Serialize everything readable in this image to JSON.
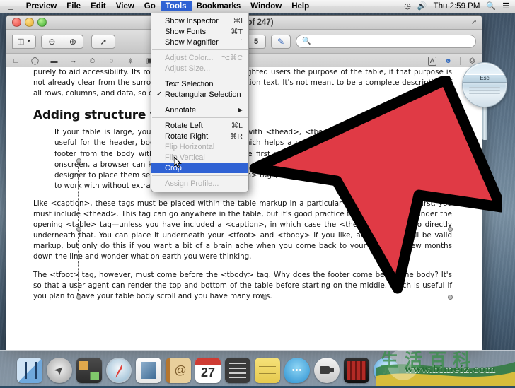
{
  "menubar": {
    "apple_icon": "apple-icon",
    "items": [
      {
        "label": "Preview",
        "selected": false
      },
      {
        "label": "File",
        "selected": false
      },
      {
        "label": "Edit",
        "selected": false
      },
      {
        "label": "View",
        "selected": false
      },
      {
        "label": "Go",
        "selected": false
      },
      {
        "label": "Tools",
        "selected": true
      },
      {
        "label": "Bookmarks",
        "selected": false
      },
      {
        "label": "Window",
        "selected": false
      },
      {
        "label": "Help",
        "selected": false
      }
    ],
    "status": {
      "timemachine_icon": "clock-icon",
      "volume_icon": "speaker-icon",
      "clock": "Thu 2:59 PM",
      "search_icon": "search-icon",
      "notification_icon": "list-icon"
    }
  },
  "window": {
    "title": "page 81 of 247)",
    "traffic": {
      "close": "close-button",
      "minimize": "minimize-button",
      "zoom": "zoom-button"
    },
    "expand_icon": "expand-icon",
    "toolbar": {
      "sidebar_label": "▥",
      "sidebar_caret": "▾",
      "zoom_out_icon": "zoom-out-icon",
      "zoom_in_icon": "zoom-in-icon",
      "share_icon": "share-icon",
      "markup_icon": "markup-pen-icon",
      "markup_caret": "▾",
      "rotate_label": "5",
      "annotate_icon": "annotate-icon",
      "search_icon": "ⓧ",
      "search_placeholder": ""
    },
    "subbar": {
      "icons": [
        "rect-select-icon",
        "oval-select-icon",
        "line-icon",
        "arrow-icon",
        "text-select-icon",
        "oval-icon",
        "cloud-icon",
        "rect-icon"
      ],
      "right_icons": [
        "text-box-icon",
        "adjust-color-icon",
        "crop-icon"
      ]
    }
  },
  "tools_menu": {
    "groups": [
      {
        "items": [
          {
            "label": "Show Inspector",
            "shortcut": "⌘I",
            "state": "normal"
          },
          {
            "label": "Show Fonts",
            "shortcut": "⌘T",
            "state": "normal"
          },
          {
            "label": "Show Magnifier",
            "shortcut": "`",
            "state": "normal"
          }
        ]
      },
      {
        "items": [
          {
            "label": "Adjust Color...",
            "shortcut": "⌥⌘C",
            "state": "disabled"
          },
          {
            "label": "Adjust Size...",
            "shortcut": "",
            "state": "disabled"
          }
        ]
      },
      {
        "items": [
          {
            "label": "Text Selection",
            "shortcut": "",
            "state": "normal"
          },
          {
            "label": "Rectangular Selection",
            "shortcut": "",
            "state": "checked"
          }
        ]
      },
      {
        "items": [
          {
            "label": "Annotate",
            "shortcut": "▶",
            "state": "submenu"
          }
        ]
      },
      {
        "items": [
          {
            "label": "Rotate Left",
            "shortcut": "⌘L",
            "state": "normal"
          },
          {
            "label": "Rotate Right",
            "shortcut": "⌘R",
            "state": "normal"
          },
          {
            "label": "Flip Horizontal",
            "shortcut": "",
            "state": "disabled"
          },
          {
            "label": "Flip Vertical",
            "shortcut": "",
            "state": "disabled"
          },
          {
            "label": "Crop",
            "shortcut": "",
            "state": "highlighted"
          }
        ]
      },
      {
        "items": [
          {
            "label": "Assign Profile...",
            "shortcut": "",
            "state": "disabled"
          }
        ]
      }
    ]
  },
  "document": {
    "paragraph_top": "purely to aid accessibility. Its role is to announce to nonsighted users the purpose of the table, if that purpose is not already clear from the surrounding content or the caption text. It's not meant to be a complete description of all rows, columns, and data, so don't overdo it.",
    "headline": "Adding structure to your tables",
    "paragraph_structure": "If your table is large, you can add more structure with <thead>, <tbody>, and <tfoot>. These tags are useful for the header, body, and footer section, which helps a user agent to distinguish the header and footer from the body without checking back on the first page to find out what's what. When displayed onscreen, a browser can keep the header and footer visible and allow the body to scroll, enabling the web designer to place them separately; much like the <th> tags, these three tags give you another styling hook to work with without extra classes.",
    "paragraph_caption": "Like <caption>, these tags must be placed within the table markup in a particular order and location. First, you must include <thead>. This tag can go anywhere in the table, but it's good practice to place it directly under the opening <table> tag—unless you have included a <caption>, in which case the <thead> tag must go directly underneath that. You can place it underneath your <tfoot> and <tbody> if you like, and it would still be valid markup, but only do this if you want a bit of a brain ache when you come back to your markup a few months down the line and wonder what on earth you were thinking.",
    "paragraph_tfoot": "The <tfoot> tag, however, must come before the <tbody> tag. Why does the footer come before the body? It's so that a user agent can render the top and bottom of the table before starting on the middle, which is useful if you plan to have your table body scroll and you have many rows."
  },
  "widget": {
    "esc_label": "Esc"
  },
  "dock": {
    "items": [
      {
        "name": "finder",
        "label": "Finder"
      },
      {
        "name": "launchpad",
        "label": "Launchpad"
      },
      {
        "name": "mission-control",
        "label": "Mission Control"
      },
      {
        "name": "safari",
        "label": "Safari"
      },
      {
        "name": "mail",
        "label": "Mail"
      },
      {
        "name": "contacts",
        "label": "Contacts"
      },
      {
        "name": "calendar",
        "label": "Calendar"
      },
      {
        "name": "reminders",
        "label": "Reminders"
      },
      {
        "name": "notes",
        "label": "Notes"
      },
      {
        "name": "messages",
        "label": "Messages"
      },
      {
        "name": "facetime",
        "label": "FaceTime"
      },
      {
        "name": "photo-booth",
        "label": "Photo Booth"
      },
      {
        "name": "itunes",
        "label": "iTunes"
      }
    ]
  },
  "watermark": {
    "characters": [
      "生",
      "活",
      "百",
      "科"
    ],
    "url": "www.bimeiz.com"
  },
  "colors": {
    "menu_highlight": "#2f62d4",
    "arrow_fill": "#e03a45",
    "arrow_stroke": "#000000",
    "watermark_green": "#3e8f4f"
  }
}
